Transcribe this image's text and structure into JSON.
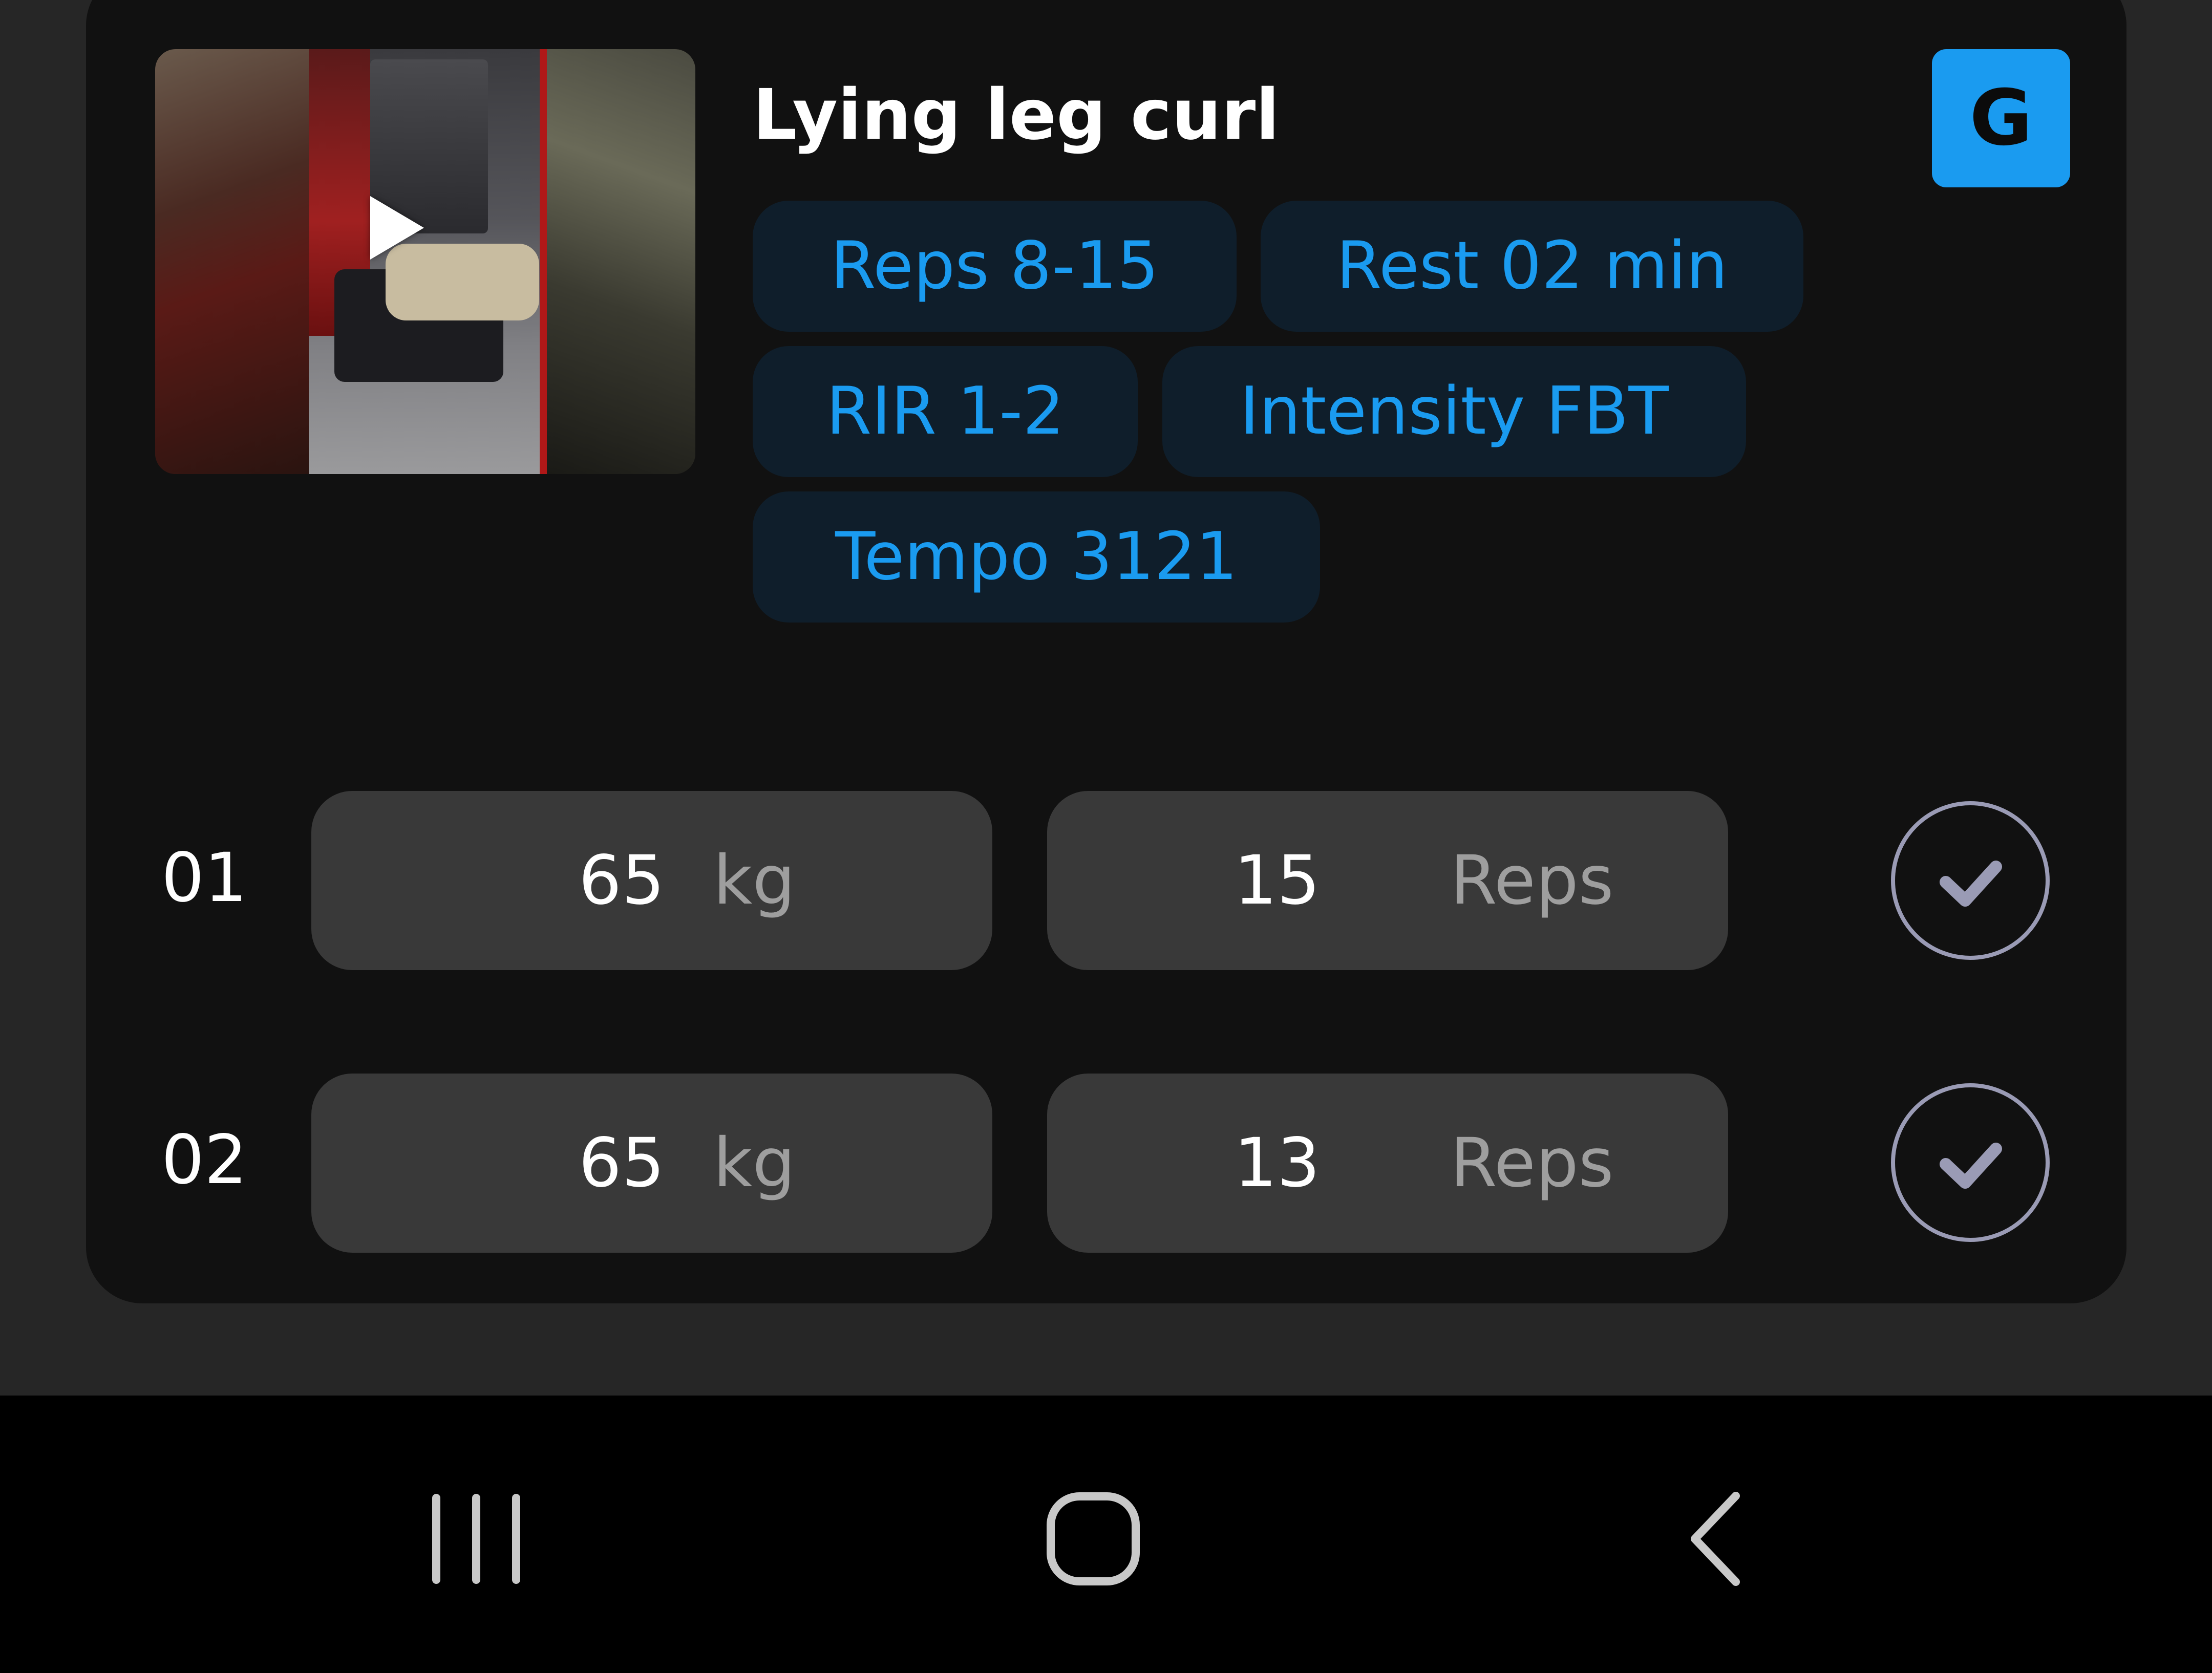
{
  "exercise": {
    "title": "Lying leg curl",
    "badge_letter": "G",
    "chips": [
      "Reps 8-15",
      "Rest 02 min",
      "RIR 1-2",
      "Intensity FBT",
      "Tempo 3121"
    ],
    "accent_color": "#1a9bf0"
  },
  "sets": [
    {
      "number": "01",
      "weight": "65",
      "weight_unit": "kg",
      "reps": "15",
      "reps_unit": "Reps"
    },
    {
      "number": "02",
      "weight": "65",
      "weight_unit": "kg",
      "reps": "13",
      "reps_unit": "Reps"
    }
  ],
  "icons": {
    "video_play": "play-icon",
    "set_complete": "check-icon",
    "nav_recents": "recents-icon",
    "nav_home": "home-icon",
    "nav_back": "back-icon"
  }
}
